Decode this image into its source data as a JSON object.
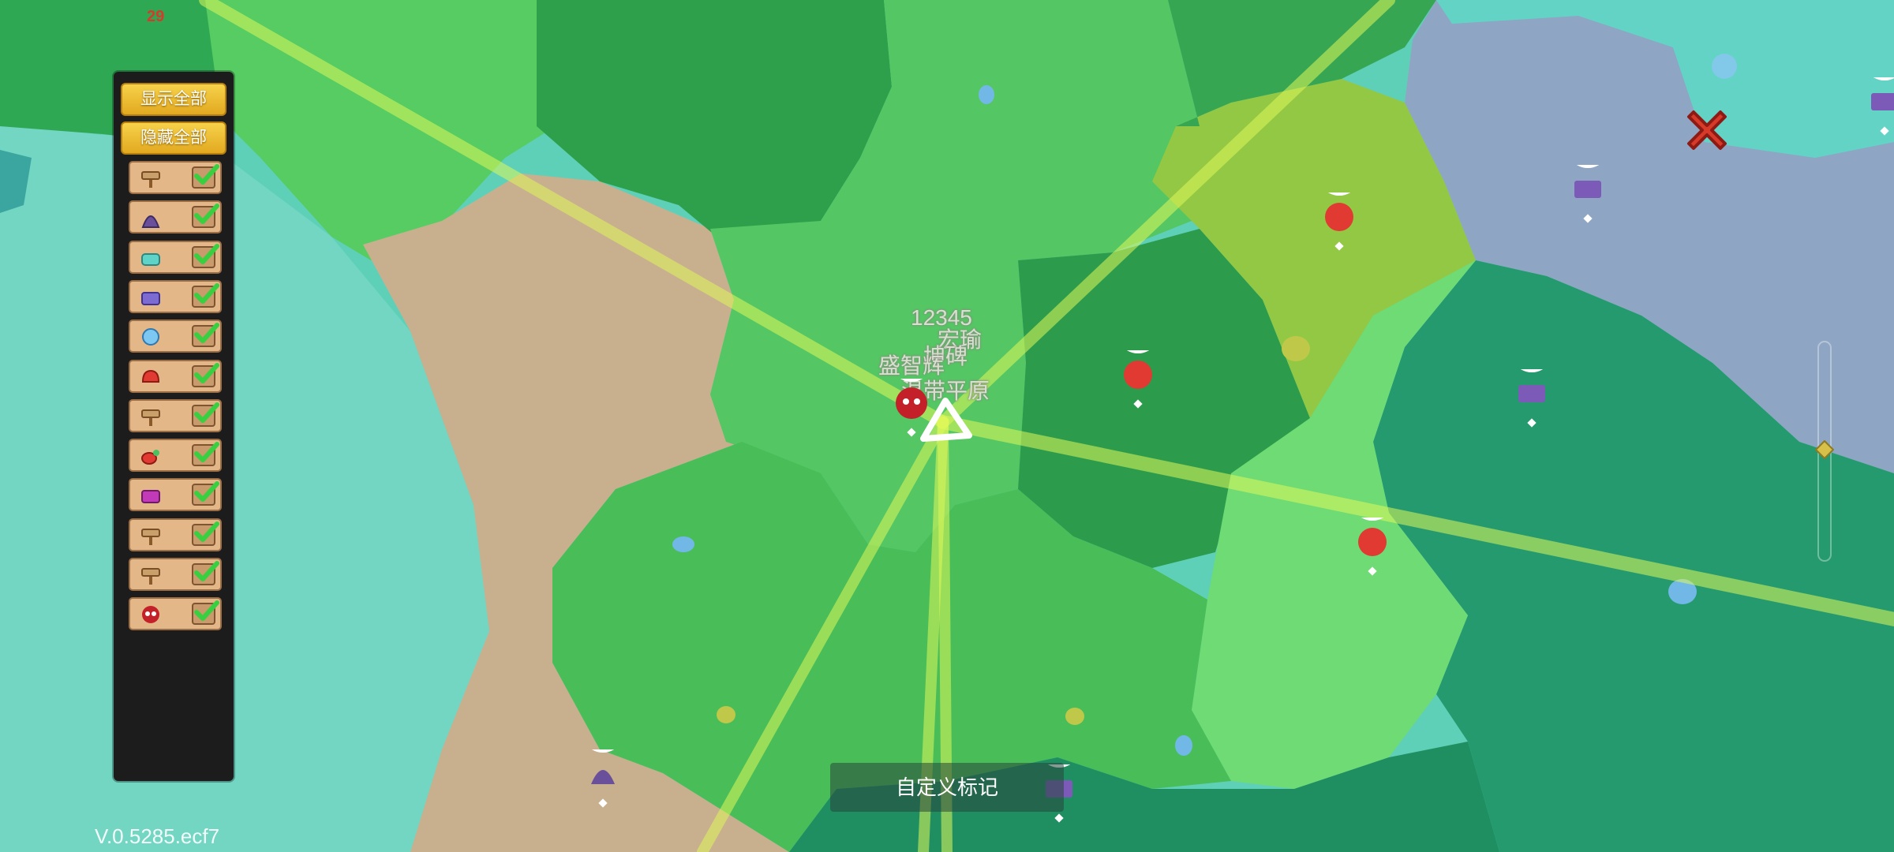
{
  "hud": {
    "show_all": "显示全部",
    "hide_all": "隐藏全部",
    "version": "V.0.5285.ecf7",
    "counter": "29",
    "custom_mark": "自定义标记"
  },
  "legend_filters": [
    {
      "icon": "signpost-icon",
      "checked": true
    },
    {
      "icon": "hooded-figure-icon",
      "checked": true
    },
    {
      "icon": "teleporter-icon",
      "checked": true
    },
    {
      "icon": "treasure-chest-icon",
      "checked": true
    },
    {
      "icon": "crystal-orb-icon",
      "checked": true
    },
    {
      "icon": "red-monster-icon",
      "checked": true
    },
    {
      "icon": "signpost-icon",
      "checked": true
    },
    {
      "icon": "red-beast-icon",
      "checked": true
    },
    {
      "icon": "purple-chest-icon",
      "checked": true
    },
    {
      "icon": "signpost-icon",
      "checked": true
    },
    {
      "icon": "signpost-icon",
      "checked": true
    },
    {
      "icon": "red-skull-icon",
      "checked": true
    }
  ],
  "map_labels": {
    "numbers": "12345",
    "label_a": "宏瑜",
    "label_b": "盛智辉",
    "label_c": "温带平原",
    "label_d": "坤碑"
  },
  "colors": {
    "panel_bg": "#1c1c1c",
    "button_yellow": "#f0c235",
    "filter_bg": "#e4b789",
    "check_green": "#38d040",
    "close_red": "#d83a2a"
  }
}
